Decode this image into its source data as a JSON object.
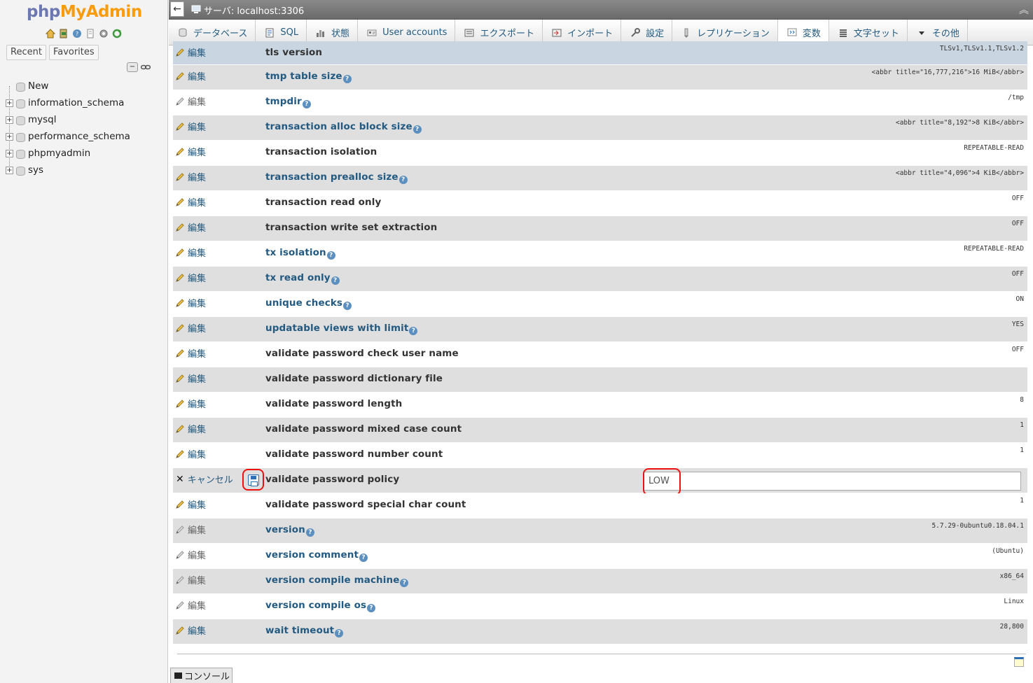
{
  "sidebar": {
    "logo": {
      "php": "php",
      "my": "My",
      "admin": "Admin"
    },
    "quick_icons": [
      "home-icon",
      "logout-icon",
      "help-icon",
      "docs-icon",
      "settings-icon",
      "reload-icon"
    ],
    "tabs": {
      "recent": "Recent",
      "favorites": "Favorites"
    },
    "tree": [
      {
        "label": "New",
        "type": "new"
      },
      {
        "label": "information_schema",
        "type": "db"
      },
      {
        "label": "mysql",
        "type": "db"
      },
      {
        "label": "performance_schema",
        "type": "db"
      },
      {
        "label": "phpmyadmin",
        "type": "db"
      },
      {
        "label": "sys",
        "type": "db"
      }
    ]
  },
  "topbar": {
    "back": "←",
    "server": "サーバ: localhost:3306"
  },
  "navtabs": [
    {
      "label": "データベース",
      "icon": "database-icon"
    },
    {
      "label": "SQL",
      "icon": "sql-icon"
    },
    {
      "label": "状態",
      "icon": "status-icon"
    },
    {
      "label": "User accounts",
      "icon": "users-icon"
    },
    {
      "label": "エクスポート",
      "icon": "export-icon"
    },
    {
      "label": "インポート",
      "icon": "import-icon"
    },
    {
      "label": "設定",
      "icon": "settings-icon"
    },
    {
      "label": "レプリケーション",
      "icon": "replication-icon"
    },
    {
      "label": "変数",
      "icon": "variables-icon",
      "active": true
    },
    {
      "label": "文字セット",
      "icon": "charset-icon"
    },
    {
      "label": "その他",
      "icon": "more-icon"
    }
  ],
  "edit_label": "編集",
  "cancel_label": "キャンセル",
  "variables": [
    {
      "name": "tls version",
      "value": "TLSv1,TLSv1.1,TLSv1.2",
      "link": false,
      "help": false
    },
    {
      "name": "tmp table size",
      "value": "<abbr title=\"16,777,216\">16 MiB</abbr>",
      "link": true,
      "help": true
    },
    {
      "name": "tmpdir",
      "value": "/tmp",
      "link": true,
      "help": true,
      "readonly": true
    },
    {
      "name": "transaction alloc block size",
      "value": "<abbr title=\"8,192\">8 KiB</abbr>",
      "link": true,
      "help": true
    },
    {
      "name": "transaction isolation",
      "value": "REPEATABLE-READ",
      "link": false,
      "help": false
    },
    {
      "name": "transaction prealloc size",
      "value": "<abbr title=\"4,096\">4 KiB</abbr>",
      "link": true,
      "help": true
    },
    {
      "name": "transaction read only",
      "value": "OFF",
      "link": false,
      "help": false
    },
    {
      "name": "transaction write set extraction",
      "value": "OFF",
      "link": false,
      "help": false
    },
    {
      "name": "tx isolation",
      "value": "REPEATABLE-READ",
      "link": true,
      "help": true
    },
    {
      "name": "tx read only",
      "value": "OFF",
      "link": true,
      "help": true
    },
    {
      "name": "unique checks",
      "value": "ON",
      "link": true,
      "help": true
    },
    {
      "name": "updatable views with limit",
      "value": "YES",
      "link": true,
      "help": true
    },
    {
      "name": "validate password check user name",
      "value": "OFF",
      "link": false,
      "help": false
    },
    {
      "name": "validate password dictionary file",
      "value": "",
      "link": false,
      "help": false
    },
    {
      "name": "validate password length",
      "value": "8",
      "link": false,
      "help": false
    },
    {
      "name": "validate password mixed case count",
      "value": "1",
      "link": false,
      "help": false
    },
    {
      "name": "validate password number count",
      "value": "1",
      "link": false,
      "help": false
    },
    {
      "name": "validate password policy",
      "value": "LOW",
      "link": false,
      "help": false,
      "editing": true
    },
    {
      "name": "validate password special char count",
      "value": "1",
      "link": false,
      "help": false
    },
    {
      "name": "version",
      "value": "5.7.29-0ubuntu0.18.04.1",
      "link": true,
      "help": true,
      "readonly": true
    },
    {
      "name": "version comment",
      "value": "(Ubuntu)",
      "link": true,
      "help": true,
      "readonly": true
    },
    {
      "name": "version compile machine",
      "value": "x86_64",
      "link": true,
      "help": true,
      "readonly": true
    },
    {
      "name": "version compile os",
      "value": "Linux",
      "link": true,
      "help": true,
      "readonly": true
    },
    {
      "name": "wait timeout",
      "value": "28,800",
      "link": true,
      "help": true
    }
  ],
  "console_label": "コンソール",
  "colors": {
    "link": "#235a81",
    "highlight_ring": "#ee1111",
    "row_alt": "#dfdfdf"
  }
}
